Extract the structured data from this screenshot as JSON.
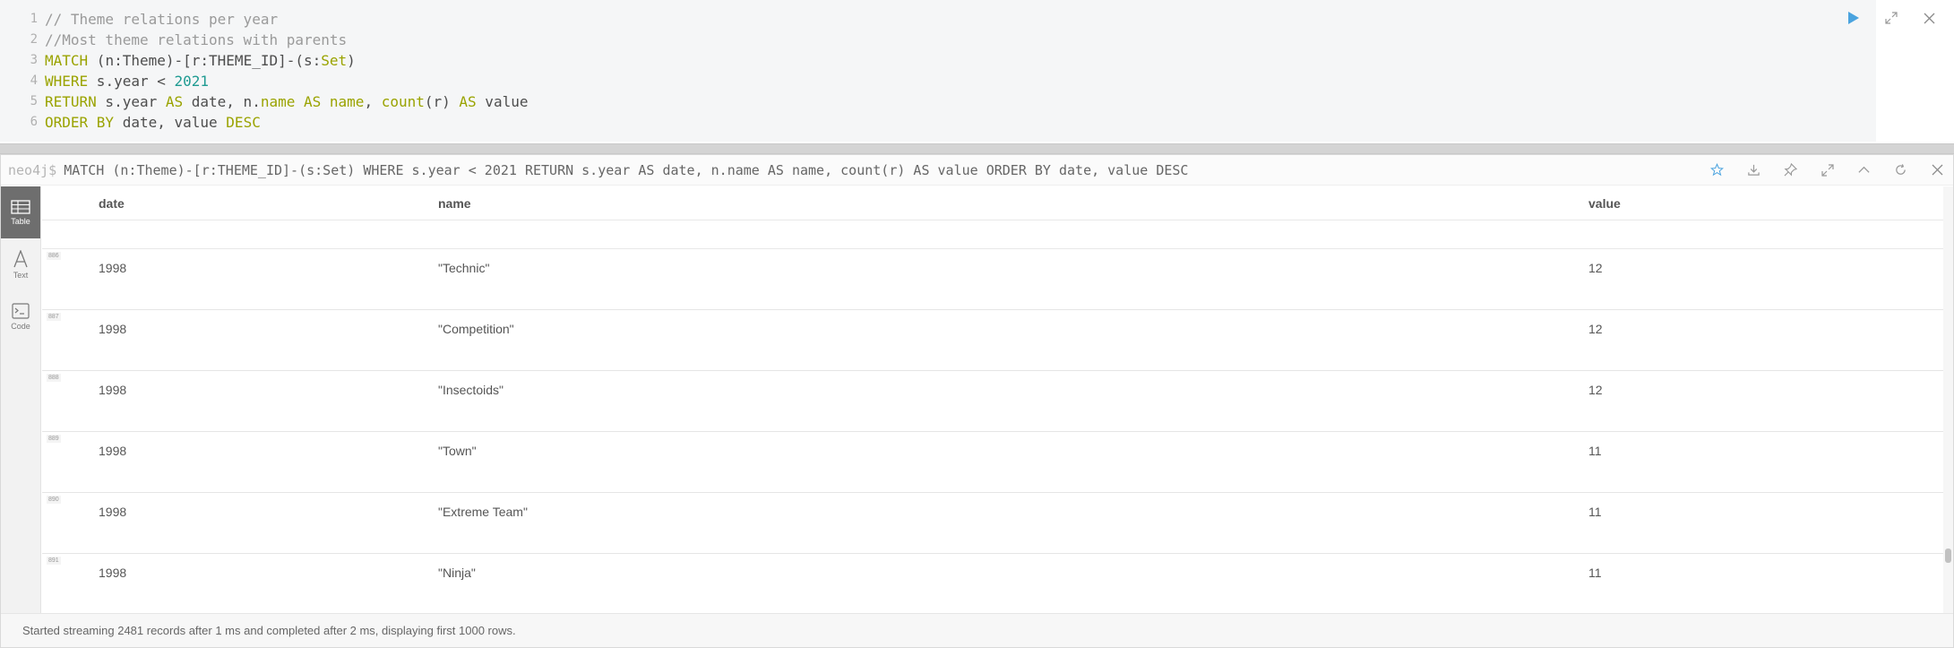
{
  "editor": {
    "lines": [
      {
        "num": "1",
        "parts": [
          {
            "t": "// Theme relations per year",
            "c": "cm"
          }
        ]
      },
      {
        "num": "2",
        "parts": [
          {
            "t": "//Most theme relations with parents",
            "c": "cm"
          }
        ]
      },
      {
        "num": "3",
        "parts": [
          {
            "t": "MATCH",
            "c": "kw"
          },
          {
            "t": " (n:Theme)-[r:THEME_ID]-(s:",
            "c": ""
          },
          {
            "t": "Set",
            "c": "kw"
          },
          {
            "t": ")",
            "c": ""
          }
        ]
      },
      {
        "num": "4",
        "parts": [
          {
            "t": "WHERE",
            "c": "kw"
          },
          {
            "t": " s.year < ",
            "c": ""
          },
          {
            "t": "2021",
            "c": "num"
          }
        ]
      },
      {
        "num": "5",
        "parts": [
          {
            "t": "RETURN",
            "c": "kw"
          },
          {
            "t": " s.year ",
            "c": ""
          },
          {
            "t": "AS",
            "c": "kw"
          },
          {
            "t": " date, n.",
            "c": ""
          },
          {
            "t": "name",
            "c": "fn"
          },
          {
            "t": " ",
            "c": ""
          },
          {
            "t": "AS",
            "c": "kw"
          },
          {
            "t": " ",
            "c": ""
          },
          {
            "t": "name",
            "c": "fn"
          },
          {
            "t": ", ",
            "c": ""
          },
          {
            "t": "count",
            "c": "fn"
          },
          {
            "t": "(r) ",
            "c": ""
          },
          {
            "t": "AS",
            "c": "kw"
          },
          {
            "t": " value",
            "c": ""
          }
        ]
      },
      {
        "num": "6",
        "parts": [
          {
            "t": "ORDER BY",
            "c": "kw"
          },
          {
            "t": " date, value ",
            "c": ""
          },
          {
            "t": "DESC",
            "c": "kw"
          }
        ]
      }
    ]
  },
  "frame": {
    "prompt": "neo4j$",
    "query": "MATCH (n:Theme)-[r:THEME_ID]-(s:Set) WHERE s.year < 2021 RETURN s.year AS date, n.name AS name, count(r) AS value ORDER BY date, value DESC"
  },
  "sidebar": {
    "tabs": [
      {
        "label": "Table",
        "icon": "table-icon"
      },
      {
        "label": "Text",
        "icon": "text-icon"
      },
      {
        "label": "Code",
        "icon": "code-icon"
      }
    ]
  },
  "table": {
    "headers": [
      "date",
      "name",
      "value"
    ],
    "rows": [
      {
        "idx": "886",
        "date": "1998",
        "name": "\"Technic\"",
        "value": "12"
      },
      {
        "idx": "887",
        "date": "1998",
        "name": "\"Competition\"",
        "value": "12"
      },
      {
        "idx": "888",
        "date": "1998",
        "name": "\"Insectoids\"",
        "value": "12"
      },
      {
        "idx": "889",
        "date": "1998",
        "name": "\"Town\"",
        "value": "11"
      },
      {
        "idx": "890",
        "date": "1998",
        "name": "\"Extreme Team\"",
        "value": "11"
      },
      {
        "idx": "891",
        "date": "1998",
        "name": "\"Ninja\"",
        "value": "11"
      }
    ]
  },
  "status": {
    "text": "Started streaming 2481 records after 1 ms and completed after 2 ms, displaying first 1000 rows."
  },
  "colors": {
    "accent": "#4aa3df",
    "keyword": "#9aa300",
    "number": "#1f9b92",
    "comment": "#9a9a9a"
  }
}
